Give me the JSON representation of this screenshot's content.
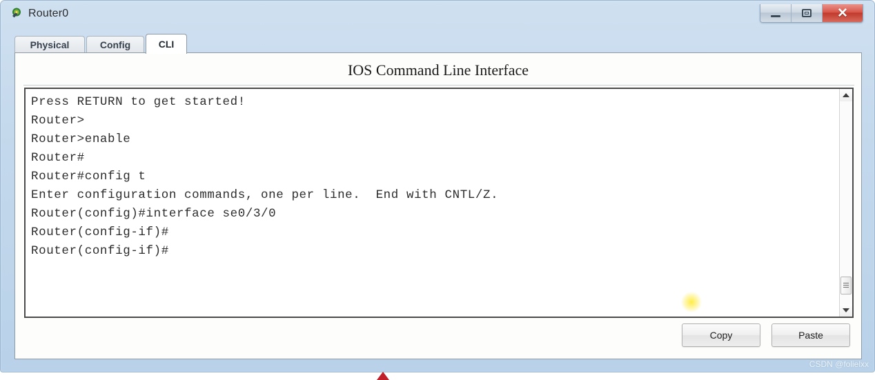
{
  "window": {
    "title": "Router0",
    "app_icon": "router-icon",
    "controls": {
      "minimize": "minimize-icon",
      "maximize": "maximize-icon",
      "close_label": "✕"
    }
  },
  "tabs": [
    {
      "label": "Physical",
      "active": false
    },
    {
      "label": "Config",
      "active": false
    },
    {
      "label": "CLI",
      "active": true
    }
  ],
  "main": {
    "heading": "IOS Command Line Interface"
  },
  "terminal": {
    "lines": [
      "Press RETURN to get started!",
      "",
      "",
      "",
      "Router>",
      "Router>enable",
      "Router#",
      "Router#config t",
      "Enter configuration commands, one per line.  End with CNTL/Z.",
      "Router(config)#interface se0/3/0",
      "Router(config-if)#",
      "Router(config-if)#"
    ]
  },
  "scrollbar": {
    "up_arrow": "scroll-up-icon",
    "down_arrow": "scroll-down-icon"
  },
  "buttons": {
    "copy": "Copy",
    "paste": "Paste"
  },
  "watermark": "CSDN @folielxx",
  "colors": {
    "frame": "#c3d8ec",
    "close_button": "#c03a2d",
    "terminal_text": "#2d2d2d",
    "marker": "#c0202a"
  }
}
